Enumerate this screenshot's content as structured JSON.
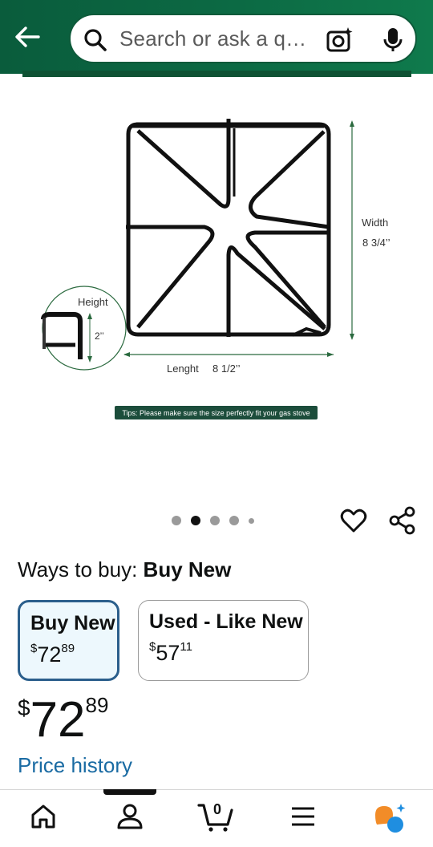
{
  "header": {
    "search_placeholder": "Search or ask a q…"
  },
  "product_image": {
    "width_label": "Width",
    "width_value": "8 3/4’’",
    "height_label": "Height",
    "height_value": "2’’",
    "length_label": "Lenght",
    "length_value": "8 1/2’’",
    "tips": "Tips: Please make sure the size perfectly fit your gas stove"
  },
  "carousel": {
    "count": 5,
    "active_index": 1
  },
  "ways_to_buy": {
    "prefix": "Ways to buy: ",
    "selected": "Buy New",
    "options": [
      {
        "label": "Buy New",
        "currency": "$",
        "whole": "72",
        "fraction": "89"
      },
      {
        "label": "Used - Like New",
        "currency": "$",
        "whole": "57",
        "fraction": "11"
      }
    ]
  },
  "price": {
    "currency": "$",
    "whole": "72",
    "fraction": "89"
  },
  "price_history_link": "Price history",
  "bottom_nav": {
    "cart_count": "0",
    "items": [
      "home-icon",
      "account-icon",
      "cart-icon",
      "menu-icon",
      "rufus-icon"
    ]
  },
  "colors": {
    "header_green": "#0c6a44",
    "selected_border": "#2b5f8c",
    "link_blue": "#1a6ba3"
  }
}
